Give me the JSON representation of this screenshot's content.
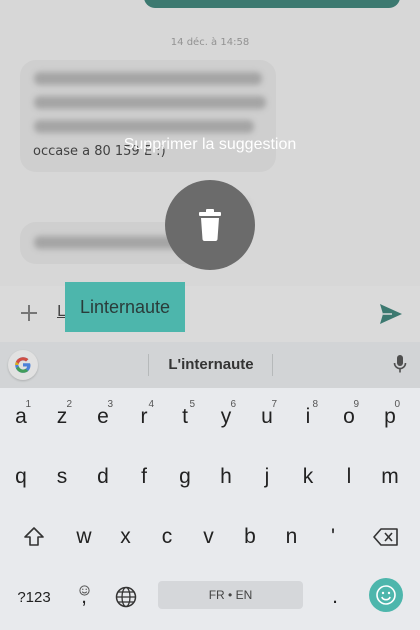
{
  "chat": {
    "timestamp": "14 déc. à 14:58",
    "message_visible_tail": "occase a 80 159 E :)"
  },
  "overlay": {
    "delete_hint": "Supprimer la suggestion",
    "icon": "trash-icon"
  },
  "compose": {
    "text": "L",
    "dragged_suggestion": "Linternaute",
    "plus_icon": "plus-icon",
    "send_icon": "send-icon"
  },
  "suggestions": {
    "logo": "google-g-icon",
    "word": "L'internaute",
    "mic_icon": "mic-icon"
  },
  "keyboard": {
    "row1": [
      {
        "k": "a",
        "h": "1"
      },
      {
        "k": "z",
        "h": "2"
      },
      {
        "k": "e",
        "h": "3"
      },
      {
        "k": "r",
        "h": "4"
      },
      {
        "k": "t",
        "h": "5"
      },
      {
        "k": "y",
        "h": "6"
      },
      {
        "k": "u",
        "h": "7"
      },
      {
        "k": "i",
        "h": "8"
      },
      {
        "k": "o",
        "h": "9"
      },
      {
        "k": "p",
        "h": "0"
      }
    ],
    "row2": [
      "q",
      "s",
      "d",
      "f",
      "g",
      "h",
      "j",
      "k",
      "l",
      "m"
    ],
    "row3": [
      "w",
      "x",
      "c",
      "v",
      "b",
      "n",
      "'"
    ],
    "symbols_label": "?123",
    "comma_label": ",",
    "space_label": "FR • EN",
    "period_label": ".",
    "accent_color": "#4db6ac"
  }
}
